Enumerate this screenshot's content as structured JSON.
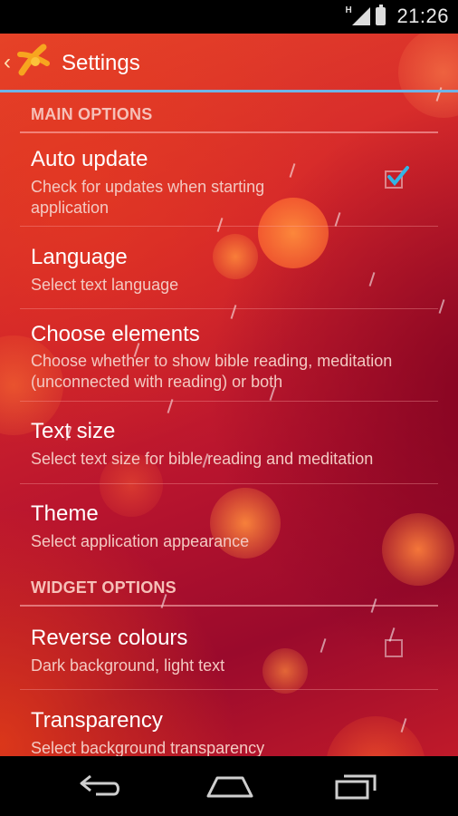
{
  "status_bar": {
    "network_label": "H",
    "time": "21:26",
    "icons": [
      "signal-icon",
      "battery-icon"
    ]
  },
  "action_bar": {
    "title": "Settings",
    "up_icon": "back-caret-icon",
    "logo_icon": "app-logo-icon",
    "accent_color": "#6fb4e8"
  },
  "main_options": {
    "header": "MAIN OPTIONS",
    "items": [
      {
        "title": "Auto update",
        "summary": "Check for updates when starting application",
        "checked": true
      },
      {
        "title": "Language",
        "summary": "Select text language"
      },
      {
        "title": "Choose elements",
        "summary": "Choose whether to show bible reading, meditation (unconnected with reading) or both"
      },
      {
        "title": "Text size",
        "summary": "Select text size for bible reading and meditation"
      },
      {
        "title": "Theme",
        "summary": "Select application appearance"
      }
    ]
  },
  "widget_options": {
    "header": "WIDGET OPTIONS",
    "items": [
      {
        "title": "Reverse colours",
        "summary": "Dark background, light text",
        "checked": false
      },
      {
        "title": "Transparency",
        "summary": "Select background transparency"
      }
    ]
  },
  "nav_bar": {
    "icons": [
      "back-icon",
      "home-icon",
      "recents-icon"
    ]
  },
  "colors": {
    "background_primary": "#d4262b",
    "background_dark": "#9a0a2c",
    "checkbox_check": "#33b5e5"
  }
}
